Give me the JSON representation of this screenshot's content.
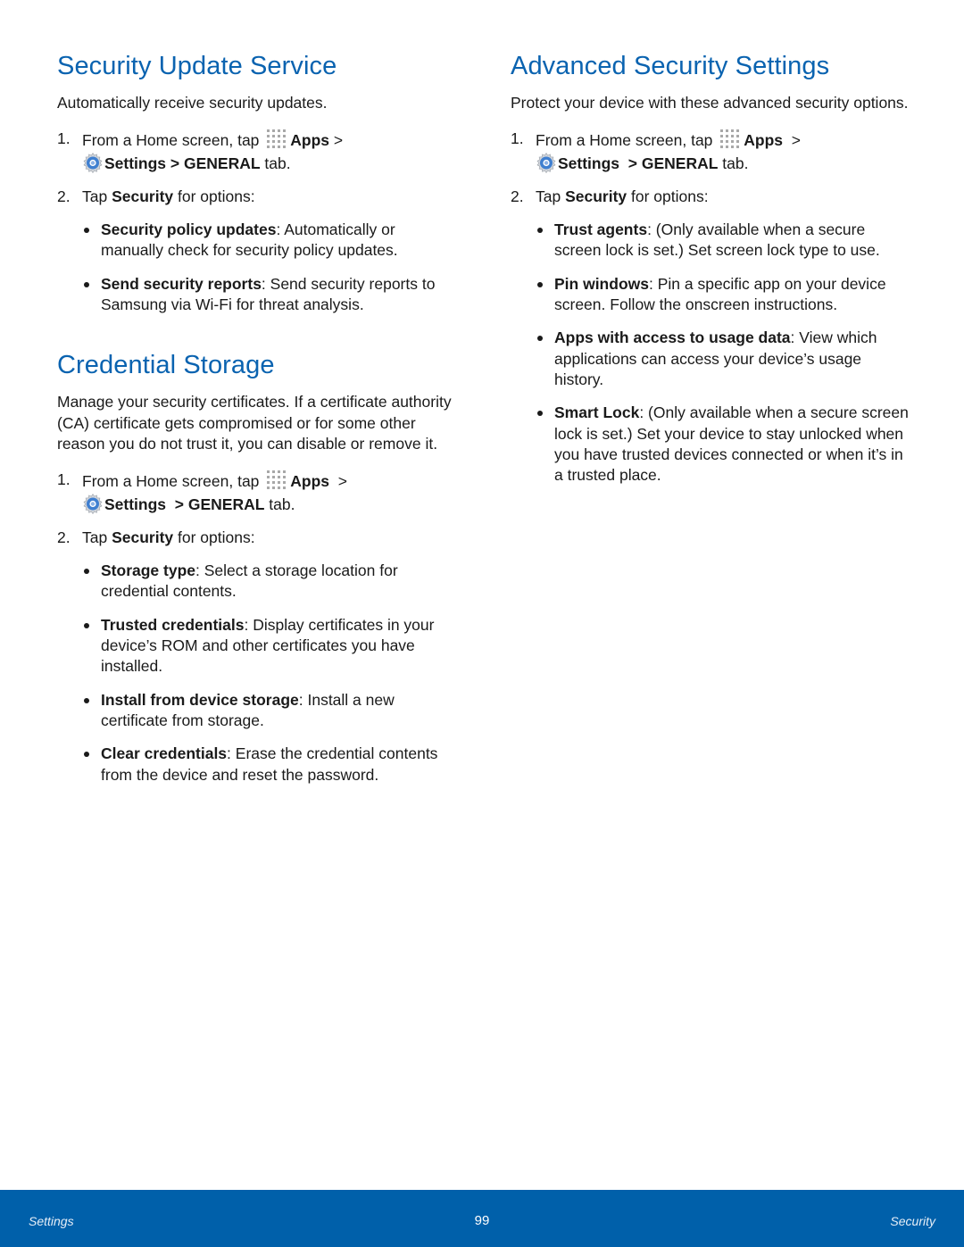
{
  "sections": {
    "security_update": {
      "title": "Security Update Service",
      "intro": "Automatically receive security updates.",
      "step1": {
        "num": "1.",
        "pre": "From a Home screen, tap ",
        "apps": "Apps",
        "sep1": " > ",
        "settings": "Settings",
        "sep2": "  > ",
        "general": "GENERAL",
        "post": " tab."
      },
      "step2": {
        "num": "2.",
        "pre": "Tap ",
        "bold": "Security",
        "post": " for options:"
      },
      "options": [
        {
          "term": "Security policy updates",
          "desc": ": Automatically or manually check for security policy updates."
        },
        {
          "term": "Send security reports",
          "desc": ": Send security reports to Samsung via Wi-Fi for threat analysis."
        }
      ]
    },
    "credential_storage": {
      "title": "Credential Storage",
      "intro": "Manage your security certificates. If a certificate authority (CA) certificate gets compromised or for some other reason you do not trust it, you can disable or remove it.",
      "step1": {
        "num": "1.",
        "pre": "From a Home screen, tap ",
        "apps": "Apps",
        "sep1": "  > ",
        "settings": "Settings",
        "sep2": "  > ",
        "general": "GENERAL",
        "post": " tab."
      },
      "step2": {
        "num": "2.",
        "pre": "Tap ",
        "bold": "Security",
        "post": " for options:"
      },
      "options": [
        {
          "term": "Storage type",
          "desc": ": Select a storage location for credential contents."
        },
        {
          "term": "Trusted credentials",
          "desc": ": Display certificates in your device’s ROM and other certificates you have installed."
        },
        {
          "term": "Install from device storage",
          "desc": ": Install a new certificate from storage."
        },
        {
          "term": "Clear credentials",
          "desc": ": Erase the credential contents from the device and reset the password."
        }
      ]
    },
    "advanced_security": {
      "title": "Advanced Security Settings",
      "intro": "Protect your device with these advanced security options.",
      "step1": {
        "num": "1.",
        "pre": "From a Home screen, tap ",
        "apps": "Apps",
        "sep1": "  > ",
        "settings": "Settings",
        "sep2": "  > ",
        "general": "GENERAL",
        "post": " tab."
      },
      "step2": {
        "num": "2.",
        "pre": "Tap ",
        "bold": "Security",
        "post": " for options:"
      },
      "options": [
        {
          "term": "Trust agents",
          "desc": ": (Only available when a secure screen lock is set.) Set screen lock type to use."
        },
        {
          "term": "Pin windows",
          "desc": ": Pin a specific app on your device screen. Follow the onscreen instructions."
        },
        {
          "term": "Apps with access to usage data",
          "desc": ": View which applications can access your device’s usage history."
        },
        {
          "term": "Smart Lock",
          "desc": ": (Only available when a secure screen lock is set.) Set your device to stay unlocked when you have trusted devices connected or when it’s in a trusted place."
        }
      ]
    }
  },
  "icons": {
    "apps": "apps-grid-icon",
    "settings": "settings-gear-icon"
  },
  "footer": {
    "left": "Settings",
    "page_number": "99",
    "right": "Security"
  },
  "colors": {
    "heading": "#0a63b0",
    "footer_bg": "#0060aa",
    "settings_icon": "#3f7fd0"
  }
}
